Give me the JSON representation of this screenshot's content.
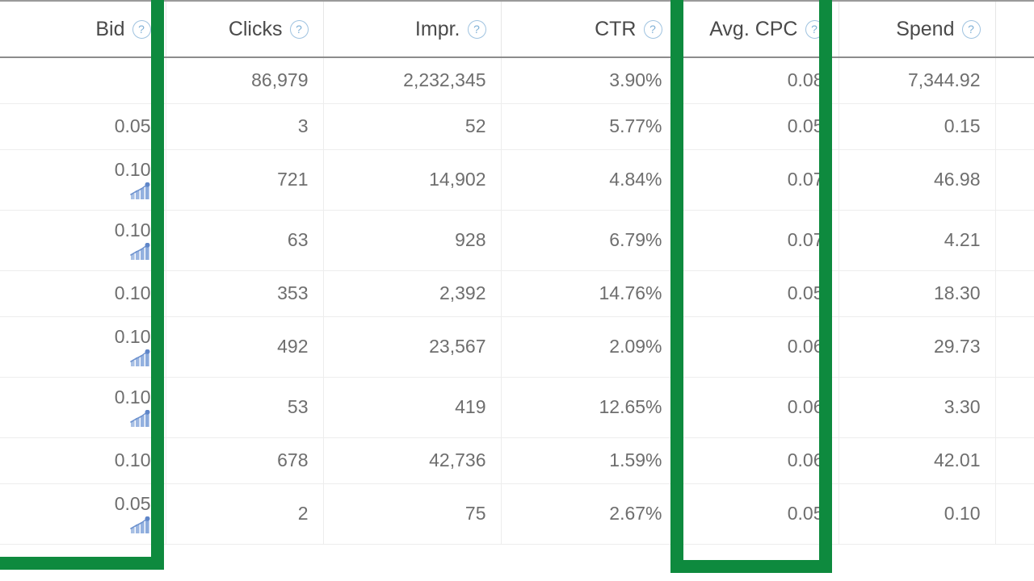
{
  "table": {
    "columns": [
      {
        "id": "bid",
        "label": "Bid",
        "help_icon": "question-circle-icon",
        "align": "right"
      },
      {
        "id": "clicks",
        "label": "Clicks",
        "help_icon": "question-circle-icon",
        "align": "right"
      },
      {
        "id": "impr",
        "label": "Impr.",
        "help_icon": "question-circle-icon",
        "align": "right"
      },
      {
        "id": "ctr",
        "label": "CTR",
        "help_icon": "question-circle-icon",
        "align": "right"
      },
      {
        "id": "cpc",
        "label": "Avg. CPC",
        "help_icon": "question-circle-icon",
        "align": "right"
      },
      {
        "id": "spend",
        "label": "Spend",
        "help_icon": "question-circle-icon",
        "align": "right"
      }
    ],
    "help_glyph": "?",
    "rows": [
      {
        "bid": "",
        "sparkline": false,
        "clicks": "86,979",
        "impr": "2,232,345",
        "ctr": "3.90%",
        "cpc": "0.08",
        "spend": "7,344.92"
      },
      {
        "bid": "0.05",
        "sparkline": false,
        "clicks": "3",
        "impr": "52",
        "ctr": "5.77%",
        "cpc": "0.05",
        "spend": "0.15"
      },
      {
        "bid": "0.10",
        "sparkline": true,
        "clicks": "721",
        "impr": "14,902",
        "ctr": "4.84%",
        "cpc": "0.07",
        "spend": "46.98"
      },
      {
        "bid": "0.10",
        "sparkline": true,
        "clicks": "63",
        "impr": "928",
        "ctr": "6.79%",
        "cpc": "0.07",
        "spend": "4.21"
      },
      {
        "bid": "0.10",
        "sparkline": false,
        "clicks": "353",
        "impr": "2,392",
        "ctr": "14.76%",
        "cpc": "0.05",
        "spend": "18.30"
      },
      {
        "bid": "0.10",
        "sparkline": true,
        "clicks": "492",
        "impr": "23,567",
        "ctr": "2.09%",
        "cpc": "0.06",
        "spend": "29.73"
      },
      {
        "bid": "0.10",
        "sparkline": true,
        "clicks": "53",
        "impr": "419",
        "ctr": "12.65%",
        "cpc": "0.06",
        "spend": "3.30"
      },
      {
        "bid": "0.10",
        "sparkline": false,
        "clicks": "678",
        "impr": "42,736",
        "ctr": "1.59%",
        "cpc": "0.06",
        "spend": "42.01"
      },
      {
        "bid": "0.05",
        "sparkline": true,
        "clicks": "2",
        "impr": "75",
        "ctr": "2.67%",
        "cpc": "0.05",
        "spend": "0.10"
      }
    ],
    "sparkline_icon": "bar-chart-trend-icon"
  },
  "annotations": [
    {
      "id": "bid-highlight",
      "target_column": "Bid",
      "color": "#0e8a3e",
      "shape": "rectangle-outline"
    },
    {
      "id": "cpc-highlight",
      "target_column": "Avg. CPC",
      "color": "#0e8a3e",
      "shape": "rectangle-outline"
    }
  ],
  "colors": {
    "annotation_green": "#0e8a3e",
    "header_text": "#4a4a4a",
    "cell_text": "#6e6e6e",
    "help_icon": "#7fb0d6",
    "sparkline": "#9cb9e0",
    "row_divider": "#ededed",
    "header_rule": "#8c8c8c"
  }
}
